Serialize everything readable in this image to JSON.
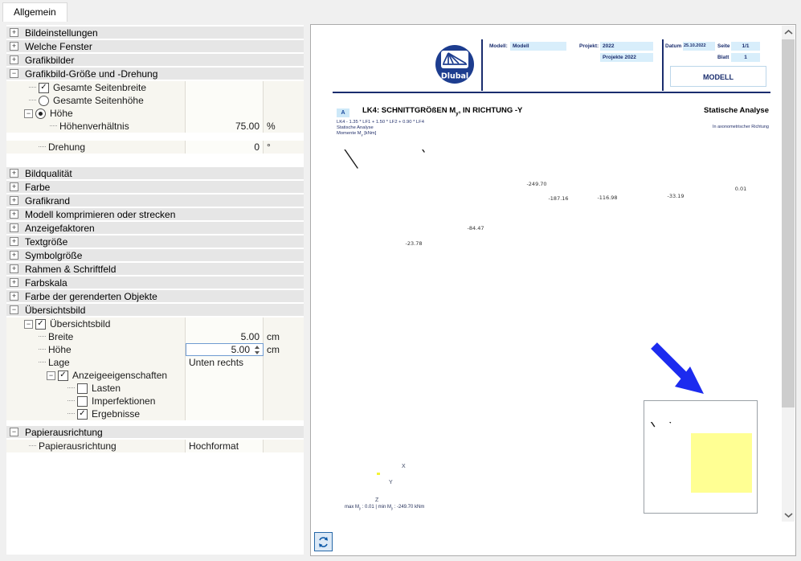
{
  "window": {
    "tab_label": "Allgemein"
  },
  "icons": {
    "expand": "+",
    "collapse": "−",
    "check": "✓"
  },
  "tree": {
    "rows": [
      {
        "label": "Bildeinstellungen"
      },
      {
        "label": "Welche Fenster"
      },
      {
        "label": "Grafikbilder"
      },
      {
        "label": "Grafikbild-Größe und -Drehung"
      },
      {
        "label": "Gesamte Seitenbreite",
        "checked": true
      },
      {
        "label": "Gesamte Seitenhöhe",
        "checked": false
      },
      {
        "label": "Höhe",
        "checked": true
      },
      {
        "label": "Höhenverhältnis",
        "value": "75.00",
        "unit": "%"
      },
      {
        "label": "Drehung",
        "value": "0",
        "unit": "°"
      },
      {
        "label": "Bildqualität"
      },
      {
        "label": "Farbe"
      },
      {
        "label": "Grafikrand"
      },
      {
        "label": "Modell komprimieren oder strecken"
      },
      {
        "label": "Anzeigefaktoren"
      },
      {
        "label": "Textgröße"
      },
      {
        "label": "Symbolgröße"
      },
      {
        "label": "Rahmen & Schriftfeld"
      },
      {
        "label": "Farbskala"
      },
      {
        "label": "Farbe der gerenderten Objekte"
      },
      {
        "label": "Übersichtsbild"
      },
      {
        "label": "Übersichtsbild",
        "checked": true
      },
      {
        "label": "Breite",
        "value": "5.00",
        "unit": "cm"
      },
      {
        "label": "Höhe",
        "value": "5.00",
        "unit": "cm",
        "focused": true
      },
      {
        "label": "Lage",
        "value": "Unten rechts"
      },
      {
        "label": "Anzeigeeigenschaften",
        "checked": true
      },
      {
        "label": "Lasten",
        "checked": false
      },
      {
        "label": "Imperfektionen",
        "checked": false
      },
      {
        "label": "Ergebnisse",
        "checked": true
      },
      {
        "label": "Papierausrichtung"
      },
      {
        "label": "Papierausrichtung",
        "value": "Hochformat"
      }
    ]
  },
  "preview": {
    "header": {
      "logo": "Dlubal",
      "model_label": "Modell:",
      "model_value": "Modell",
      "project_label": "Projekt:",
      "project_value_1": "2022",
      "project_value_2": "Projekte 2022",
      "date_label": "Datum",
      "date_value": "25.10.2022",
      "page_label": "Seite",
      "page_value": "1/1",
      "sheet_label": "Blatt",
      "sheet_value": "1",
      "doc_box": "MODELL"
    },
    "section": {
      "marker": "A",
      "title_pre": "LK4: SCHNITTGRÖßEN M",
      "title_sub": "y",
      "title_post": ", IN RICHTUNG -Y",
      "analysis_title": "Statische Analyse",
      "combo_line": "LK4 - 1.35 * LF1 + 1.50 * LF2 + 0.90 * LF4",
      "analysis_line": "Statische Analyse",
      "result_pre": "Momente M",
      "result_sub": "y",
      "result_post": " [kNm]",
      "direction_note": "In axonometrischer Richtung"
    },
    "diagram": {
      "values": {
        "v1": "-23.78",
        "v2": "-84.47",
        "v3": "-249.70",
        "v4": "-187.16",
        "v5": "-116.98",
        "v6": "-33.19",
        "v7": "0.01"
      },
      "axis_x": "X",
      "axis_y": "Y",
      "axis_z": "Z",
      "summary_pre": "max M",
      "summary_sub1": "y",
      "summary_mid": " : 0.01  |  min M",
      "summary_sub2": "y",
      "summary_post": " : -249.70 kNm"
    }
  }
}
